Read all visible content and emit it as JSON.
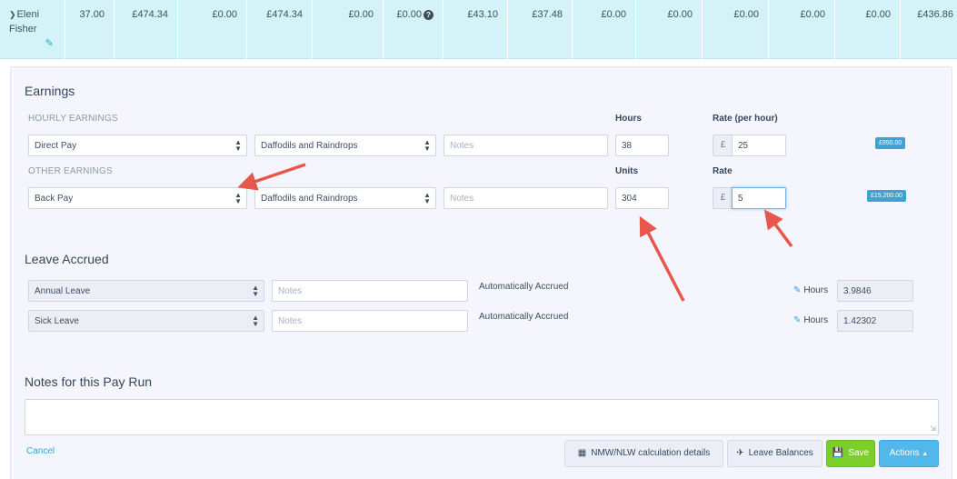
{
  "summary": {
    "employee_first": "Eleni",
    "employee_last": "Fisher",
    "cells": [
      "37.00",
      "£474.34",
      "£0.00",
      "£474.34",
      "£0.00",
      "£0.00",
      "£43.10",
      "£37.48",
      "£0.00",
      "£0.00",
      "£0.00",
      "£0.00",
      "£0.00",
      "£436.86"
    ]
  },
  "earnings": {
    "title": "Earnings",
    "hourly_label": "HOURLY EARNINGS",
    "hours_col": "Hours",
    "rate_per_hour_col": "Rate (per hour)",
    "hourly_row": {
      "type": "Direct Pay",
      "project": "Daffodils and Raindrops",
      "notes_placeholder": "Notes",
      "hours": "38",
      "currency": "£",
      "rate": "25",
      "total": "£950.00"
    },
    "other_label": "OTHER EARNINGS",
    "units_col": "Units",
    "rate_col": "Rate",
    "other_row": {
      "type": "Back Pay",
      "project": "Daffodils and Raindrops",
      "notes_placeholder": "Notes",
      "units": "304",
      "currency": "£",
      "rate": "5",
      "total": "£15,200.00"
    }
  },
  "leave": {
    "title": "Leave Accrued",
    "rows": [
      {
        "type": "Annual Leave",
        "notes_placeholder": "Notes",
        "status": "Automatically Accrued",
        "hours_label": "Hours",
        "hours": "3.9846"
      },
      {
        "type": "Sick Leave",
        "notes_placeholder": "Notes",
        "status": "Automatically Accrued",
        "hours_label": "Hours",
        "hours": "1.42302"
      }
    ]
  },
  "notes": {
    "title": "Notes for this Pay Run"
  },
  "footer": {
    "cancel": "Cancel",
    "nmw": "NMW/NLW calculation details",
    "leave_balances": "Leave Balances",
    "save": "Save",
    "actions": "Actions"
  },
  "colors": {
    "summary_bg": "#d4f3f9",
    "panel_bg": "#f5f5fd",
    "accent_blue": "#2fa5d8",
    "save_green": "#7ccf2a",
    "actions_blue": "#52b7ea",
    "annotation_red": "#e8574b"
  }
}
